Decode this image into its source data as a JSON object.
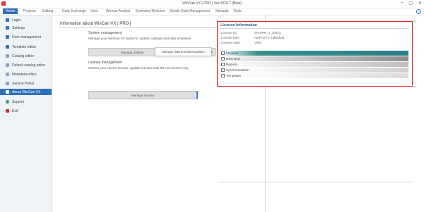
{
  "window": {
    "title": "WinCan VX | PRO | Ver.2024.7 (Beta)",
    "controls": [
      "–",
      "▢",
      "✕"
    ]
  },
  "menu": {
    "items": [
      "Home",
      "Projects",
      "Editing",
      "Data Exchange",
      "View",
      "Wincan Analyst",
      "Extended Modules",
      "Mobile Data Management",
      "Manuals",
      "Tools"
    ],
    "help_icon": "?"
  },
  "sidebar": {
    "items": [
      {
        "label": "Login",
        "icon": "login-icon",
        "color": "#2f6fb8"
      },
      {
        "label": "Settings",
        "icon": "settings-icon",
        "color": "#2f6fb8"
      },
      {
        "label": "User management",
        "icon": "user-management-icon",
        "color": "#2f6fb8"
      },
      {
        "label": "Template editor",
        "icon": "template-editor-icon",
        "color": "#2f6fb8"
      },
      {
        "label": "Catalog editor",
        "icon": "catalog-editor-icon",
        "color": "#8aa3bf"
      },
      {
        "label": "Default catalog editor",
        "icon": "default-catalog-icon",
        "color": "#8aa3bf"
      },
      {
        "label": "Metadata editor",
        "icon": "metadata-editor-icon",
        "color": "#8aa3bf"
      },
      {
        "label": "Service Portal",
        "icon": "service-portal-icon",
        "color": "#8aa3bf"
      },
      {
        "label": "About WinCan VX",
        "icon": "info-icon",
        "color": "#2f6fb8"
      },
      {
        "label": "Support",
        "icon": "support-icon",
        "color": "#2e9e58"
      },
      {
        "label": "Exit",
        "icon": "exit-icon",
        "color": "#d9342b"
      }
    ]
  },
  "main": {
    "title": "Information about WinCan VX | PRO |",
    "system": {
      "title": "System management",
      "desc": "Manage your WinCan VX systems, update catalogs and data templates",
      "button": "Manage System",
      "dropdown": "Manage data template/updates"
    },
    "license": {
      "title": "License management",
      "desc": "Review your current license, update licenses with the new license key",
      "button": "Manage license"
    }
  },
  "license_info": {
    "title": "License Information",
    "fields": [
      {
        "key": "License ID",
        "value": "WVXPR_4_40041"
      },
      {
        "key": "License type",
        "value": "NetPro/VX individual"
      },
      {
        "key": "License state",
        "value": "Valid"
      }
    ],
    "modules": [
      "Modules",
      "Extended",
      "Reports",
      "Synchronization",
      "Templates"
    ]
  }
}
